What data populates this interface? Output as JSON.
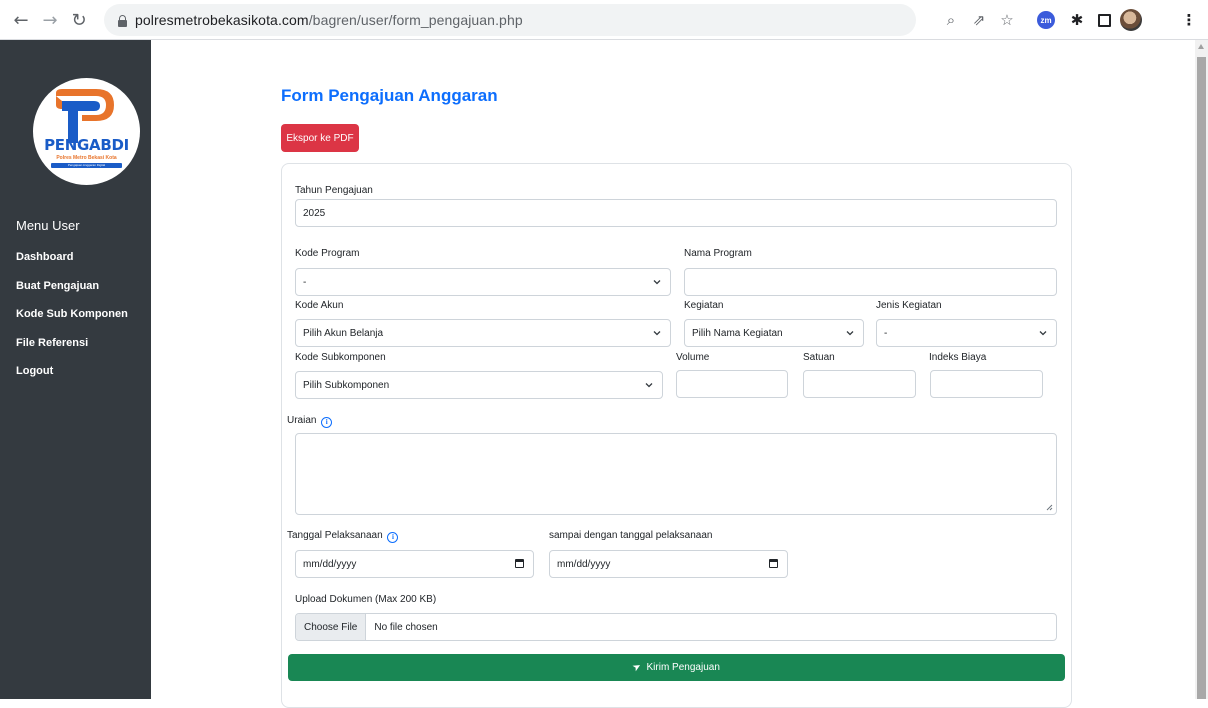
{
  "browser": {
    "url_host": "polresmetrobekasikota.com",
    "url_path": "/bagren/user/form_pengajuan.php",
    "extension_zm_label": "zm"
  },
  "sidebar": {
    "logo": {
      "name": "PENGABDI",
      "subtitle": "Polres Metro Bekasi Kota",
      "tagline": "Pengajuan Anggaran Digital"
    },
    "menu_title": "Menu User",
    "items": [
      {
        "label": "Dashboard"
      },
      {
        "label": "Buat Pengajuan"
      },
      {
        "label": "Kode Sub Komponen"
      },
      {
        "label": "File Referensi"
      },
      {
        "label": "Logout"
      }
    ]
  },
  "main": {
    "title": "Form Pengajuan Anggaran",
    "export_label": "Ekspor ke PDF",
    "form": {
      "tahun_label": "Tahun Pengajuan",
      "tahun_value": "2025",
      "kode_program_label": "Kode Program",
      "kode_program_value": "-",
      "nama_program_label": "Nama Program",
      "nama_program_value": "",
      "kode_akun_label": "Kode Akun",
      "kode_akun_value": "Pilih Akun Belanja",
      "kegiatan_label": "Kegiatan",
      "kegiatan_value": "Pilih Nama Kegiatan",
      "jenis_kegiatan_label": "Jenis Kegiatan",
      "jenis_kegiatan_value": "-",
      "kode_subkomponen_label": "Kode Subkomponen",
      "kode_subkomponen_value": "Pilih Subkomponen",
      "volume_label": "Volume",
      "volume_value": "",
      "satuan_label": "Satuan",
      "satuan_value": "",
      "indeks_biaya_label": "Indeks Biaya",
      "indeks_biaya_value": "",
      "uraian_label": "Uraian",
      "uraian_value": "",
      "tanggal_label": "Tanggal Pelaksanaan",
      "tanggal_value": "mm/dd/yyyy",
      "sampai_label": "sampai dengan tanggal pelaksanaan",
      "sampai_value": "mm/dd/yyyy",
      "upload_label": "Upload Dokumen (Max 200 KB)",
      "choose_file_label": "Choose File",
      "no_file_label": "No file chosen",
      "submit_label": "Kirim Pengajuan"
    }
  },
  "colors": {
    "sidebar_bg": "#343a40",
    "primary": "#0d6efd",
    "danger": "#dc3545",
    "success": "#198754"
  },
  "icons": {
    "info": "i",
    "send": "➤"
  }
}
